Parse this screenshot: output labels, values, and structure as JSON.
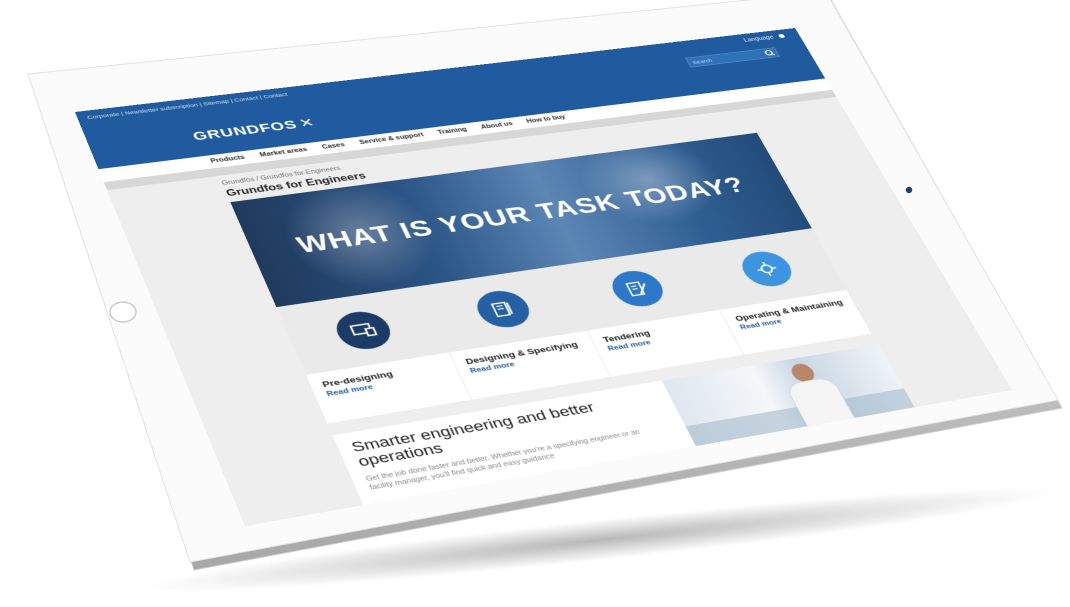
{
  "header": {
    "utility_links": "Corporate | Newsletter subscription | Sitemap | Contact | Contact",
    "lang_label": "Language",
    "search_placeholder": "Search"
  },
  "brand": {
    "name": "GRUNDFOS",
    "mark": "✕"
  },
  "nav": {
    "items": [
      "Products",
      "Market areas",
      "Cases",
      "Service & support",
      "Training",
      "About us",
      "How to buy"
    ]
  },
  "page": {
    "breadcrumb": "Grundfos / Grundfos for Engineers",
    "title": "Grundfos for Engineers"
  },
  "hero": {
    "heading": "WHAT IS YOUR TASK TODAY?"
  },
  "tasks": [
    {
      "label": "Pre-designing",
      "link": "Read more",
      "icon": "monitor-icon",
      "color": "#1b3a66"
    },
    {
      "label": "Designing & Specifying",
      "link": "Read more",
      "icon": "blueprint-icon",
      "color": "#2660a4"
    },
    {
      "label": "Tendering",
      "link": "Read more",
      "icon": "document-pen-icon",
      "color": "#2d78c8"
    },
    {
      "label": "Operating & Maintaining",
      "link": "Read more",
      "icon": "gear-icon",
      "color": "#3d95e0"
    }
  ],
  "promo": {
    "heading": "Smarter engineering and better operations",
    "text": "Get the job done faster and better. Whether you're a specifying engineer or an facility manager, you'll find quick and easy guidance"
  },
  "colors": {
    "brand_blue": "#1f5b9e",
    "tablet_frame": "#fafafa"
  }
}
